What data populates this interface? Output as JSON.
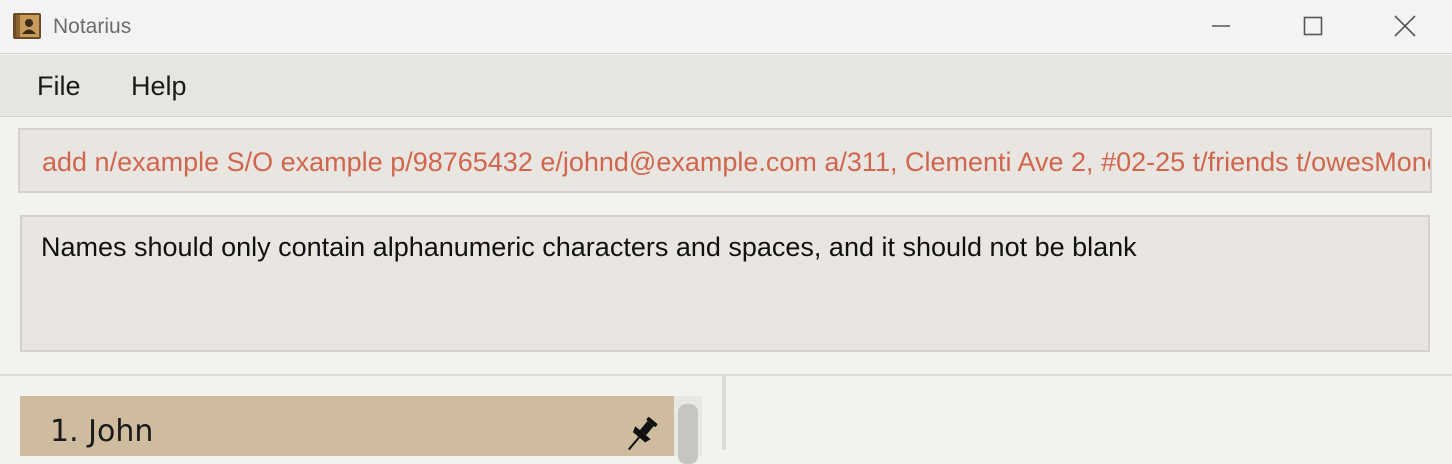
{
  "window": {
    "title": "Notarius"
  },
  "menu": {
    "items": [
      {
        "label": "File"
      },
      {
        "label": "Help"
      }
    ]
  },
  "command": {
    "value": "add n/example S/O example p/98765432 e/johnd@example.com a/311, Clementi Ave 2, #02-25 t/friends t/owesMoney"
  },
  "result": {
    "message": "Names should only contain alphanumeric characters and spaces, and it should not be blank"
  },
  "person_list": {
    "items": [
      {
        "index_name": "1. John",
        "pinned": true
      }
    ]
  },
  "colors": {
    "command_error_text": "#d0664e",
    "card_background": "#cfbc9f"
  }
}
